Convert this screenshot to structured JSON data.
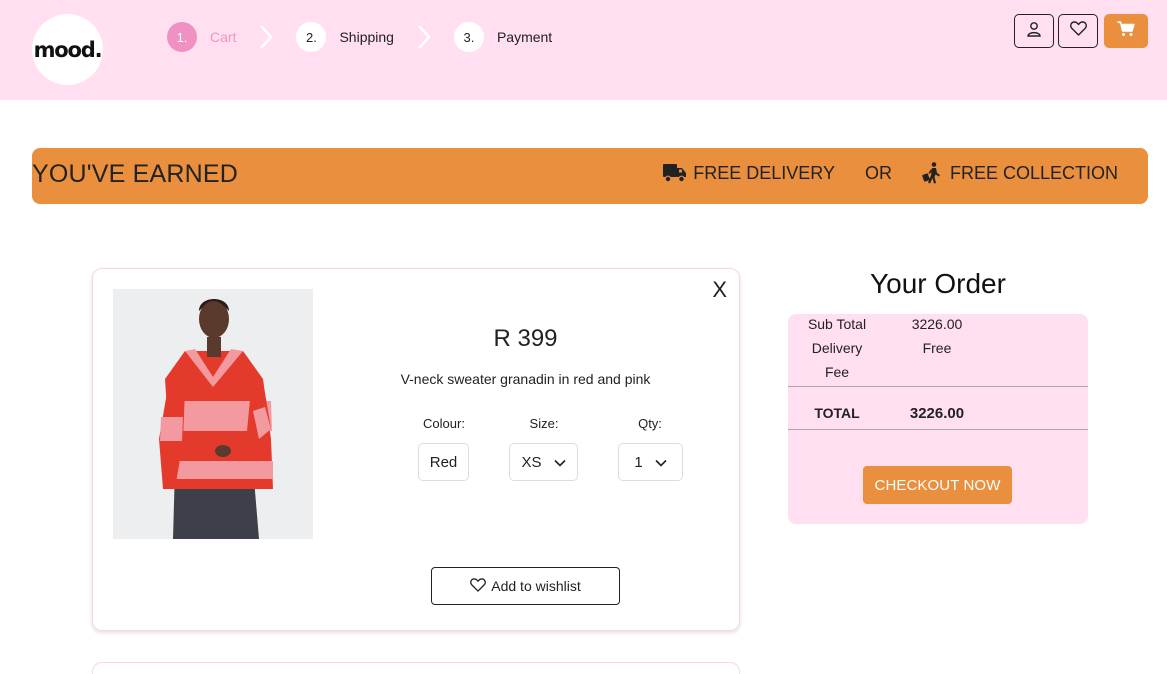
{
  "header": {
    "logo_text": "mood.",
    "steps": [
      {
        "number": "1.",
        "label": "Cart",
        "active": true
      },
      {
        "number": "2.",
        "label": "Shipping",
        "active": false
      },
      {
        "number": "3.",
        "label": "Payment",
        "active": false
      }
    ],
    "icons": [
      "user-icon",
      "heart-icon",
      "cart-icon"
    ]
  },
  "banner": {
    "title": "YOU'VE EARNED",
    "delivery": "FREE DELIVERY",
    "or": "OR",
    "collection": "FREE COLLECTION"
  },
  "product": {
    "price": "R 399",
    "name": "V-neck sweater granadin in red and pink",
    "colour_label": "Colour:",
    "colour_value": "Red",
    "size_label": "Size:",
    "size_value": "XS",
    "qty_label": "Qty:",
    "qty_value": "1",
    "close_symbol": "X",
    "wishlist_label": "Add to wishlist"
  },
  "order": {
    "title": "Your Order",
    "subtotal_label": "Sub Total",
    "subtotal_value": "3226.00",
    "delivery_label_1": "Delivery",
    "delivery_label_2": "Fee",
    "delivery_value": "Free",
    "total_label": "TOTAL",
    "total_value": "3226.00",
    "checkout_label": "CHECKOUT NOW"
  },
  "colors": {
    "header_bg": "#ffdff0",
    "accent_orange": "#e98f3e",
    "active_step_pink": "#ef91c3"
  }
}
